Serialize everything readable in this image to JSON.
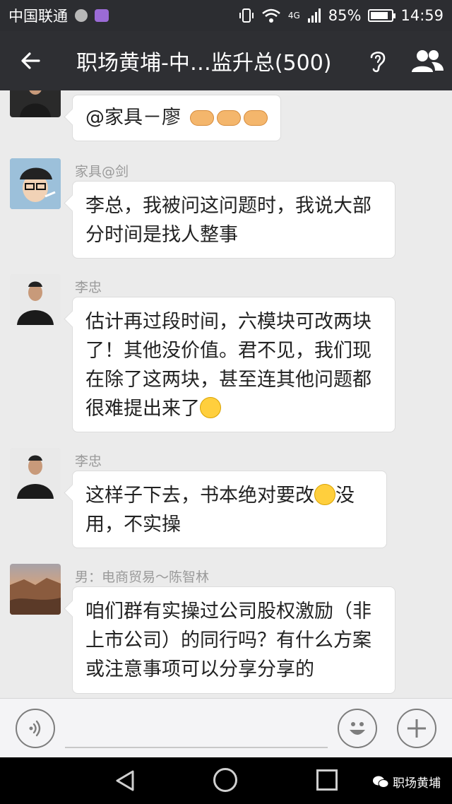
{
  "status_bar": {
    "carrier": "中国联通",
    "network": "4G",
    "battery": "85%",
    "battery_level": 0.85,
    "time": "14:59"
  },
  "title_bar": {
    "title": "职场黄埔-中…监升总(500)",
    "icons": [
      "back-arrow-icon",
      "ear-icon",
      "group-members-icon"
    ]
  },
  "messages": [
    {
      "sender": "",
      "text": "@家具－廖",
      "emoji": "handshake-icon"
    },
    {
      "sender": "家具@剑",
      "lines": [
        "李总，我被问这问题时，我说大部",
        "分时间是找人整事"
      ]
    },
    {
      "sender": "李忠",
      "lines": [
        "估计再过段时间，六模块可改两块",
        "了！其他没价值。君不见，我们现",
        "在除了这两块，甚至连其他问题都",
        "很难提出来了"
      ],
      "emoji": "smile-icon"
    },
    {
      "sender": "李忠",
      "line1a": "这样子下去，书本绝对要改",
      "line1b": "没",
      "line2": "用，不实操",
      "emoji": "thinking-icon"
    },
    {
      "sender": "男：电商贸易～陈智林",
      "lines": [
        "咱们群有实操过公司股权激励（非",
        "上市公司）的同行吗？有什么方案",
        "或注意事项可以分享分享的"
      ]
    }
  ],
  "input_bar": {
    "icons": [
      "voice-icon",
      "emoji-icon",
      "plus-icon"
    ]
  },
  "nav_bar": {
    "watermark": "职场黄埔"
  },
  "colors": {
    "header_bg": "#2e2f33",
    "chat_bg": "#ebebeb",
    "bubble_bg": "#ffffff"
  }
}
